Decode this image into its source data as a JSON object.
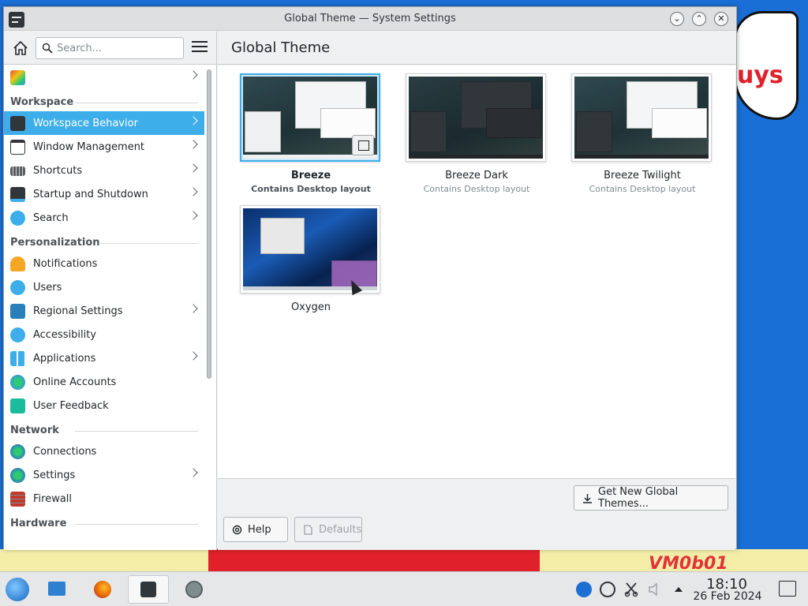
{
  "window": {
    "title": "Global Theme — System Settings"
  },
  "sidebar": {
    "search_placeholder": "Search...",
    "categories": {
      "workspace": "Workspace",
      "personalization": "Personalization",
      "network": "Network",
      "hardware": "Hardware"
    },
    "items": {
      "workspace_behavior": "Workspace Behavior",
      "window_management": "Window Management",
      "shortcuts": "Shortcuts",
      "startup_shutdown": "Startup and Shutdown",
      "search": "Search",
      "notifications": "Notifications",
      "users": "Users",
      "regional_settings": "Regional Settings",
      "accessibility": "Accessibility",
      "applications": "Applications",
      "online_accounts": "Online Accounts",
      "user_feedback": "User Feedback",
      "connections": "Connections",
      "settings": "Settings",
      "firewall": "Firewall"
    }
  },
  "main": {
    "title": "Global Theme",
    "themes": [
      {
        "name": "Breeze",
        "subtitle": "Contains Desktop layout",
        "selected": true
      },
      {
        "name": "Breeze Dark",
        "subtitle": "Contains Desktop layout",
        "selected": false
      },
      {
        "name": "Breeze Twilight",
        "subtitle": "Contains Desktop layout",
        "selected": false
      },
      {
        "name": "Oxygen",
        "subtitle": "",
        "selected": false
      }
    ],
    "get_new_label": "Get New Global Themes...",
    "help_label": "Help",
    "defaults_label": "Defaults"
  },
  "wallpaper": {
    "cloud_text": "uys",
    "corner_text": "VM0b01"
  },
  "taskbar": {
    "time": "18:10",
    "date": "26 Feb 2024"
  },
  "colors": {
    "accent": "#3daee9",
    "window_bg": "#eff0f1"
  }
}
